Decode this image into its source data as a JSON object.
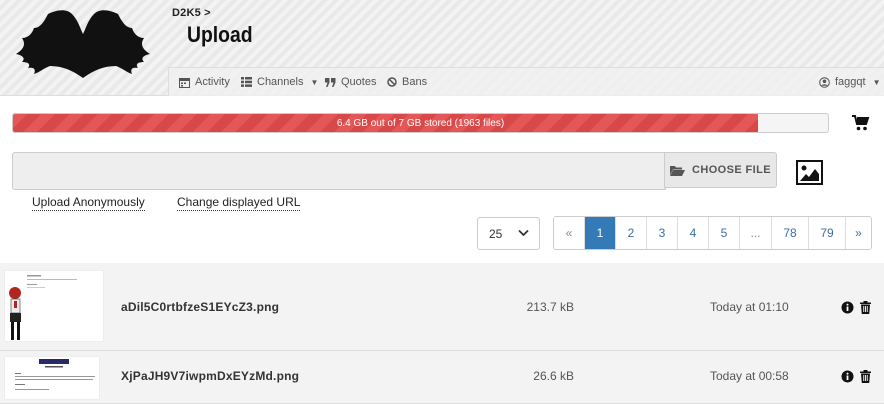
{
  "header": {
    "breadcrumb": "D2K5 >",
    "title": "Upload"
  },
  "nav": {
    "activity": "Activity",
    "channels": "Channels",
    "quotes": "Quotes",
    "bans": "Bans",
    "user": "faggqt"
  },
  "storage": {
    "text": "6.4 GB out of 7 GB stored (1963 files)",
    "used_fraction": 0.9143
  },
  "upload": {
    "choose_file": "CHOOSE FILE",
    "anonymous": "Upload Anonymously",
    "change_url": "Change displayed URL"
  },
  "per_page": "25",
  "pagination": {
    "prev": "«",
    "pages": [
      "1",
      "2",
      "3",
      "4",
      "5",
      "...",
      "78",
      "79"
    ],
    "next": "»",
    "active": "1"
  },
  "files": [
    {
      "name": "aDil5C0rtbfzeS1EYcZ3.png",
      "size": "213.7 kB",
      "time": "Today at 01:10"
    },
    {
      "name": "XjPaJH9V7iwpmDxEYzMd.png",
      "size": "26.6 kB",
      "time": "Today at 00:58"
    }
  ],
  "colors": {
    "storage_fill": "#e35757",
    "pagination_active": "#337ab7",
    "link": "#3a6ea5"
  }
}
